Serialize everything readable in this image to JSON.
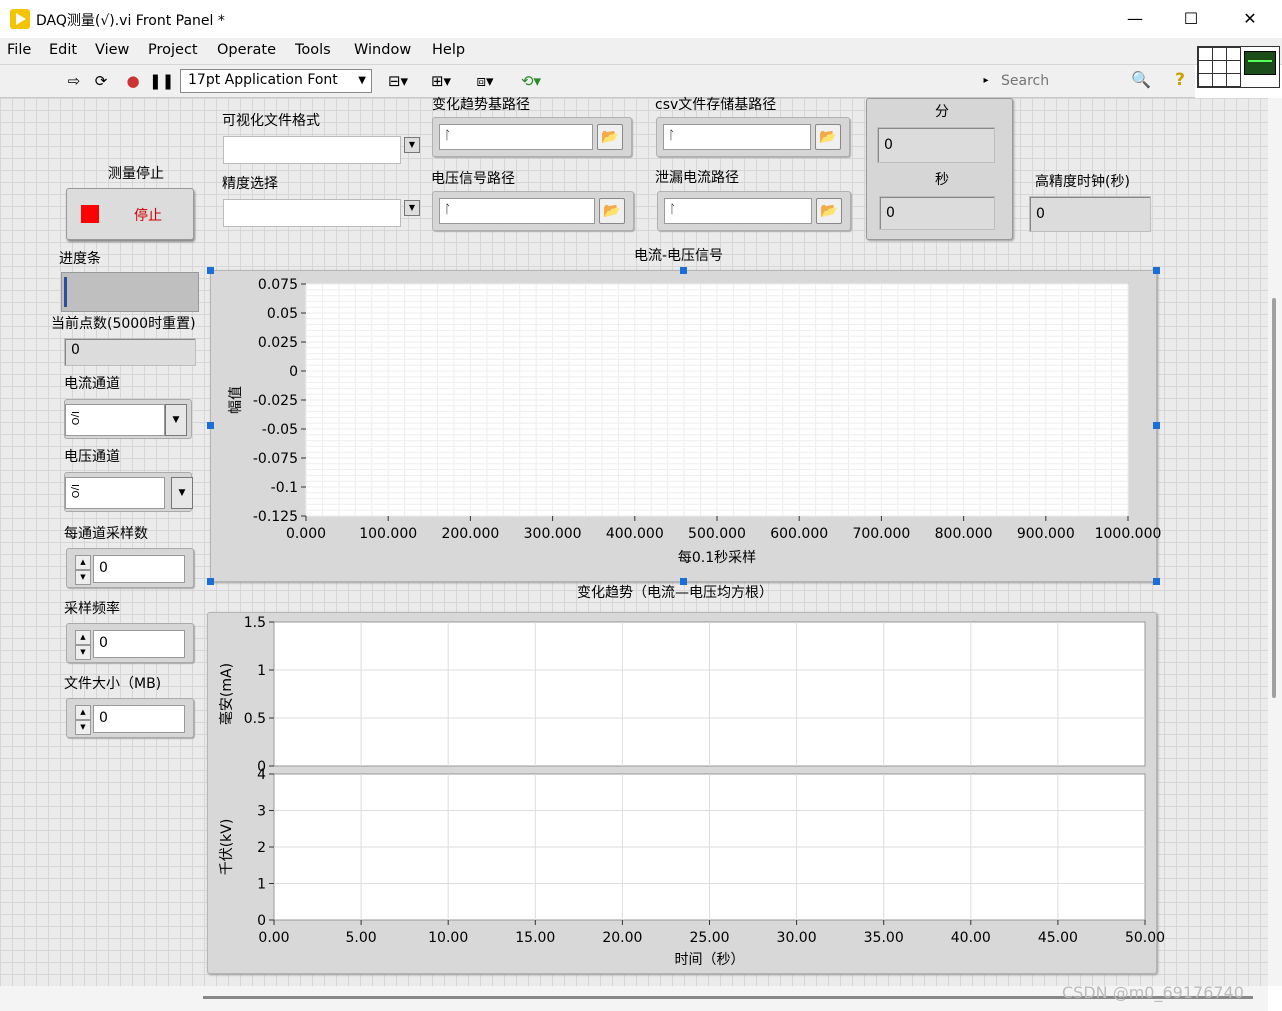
{
  "window": {
    "title": "DAQ测量(√).vi Front Panel *",
    "min": "—",
    "max": "☐",
    "close": "✕"
  },
  "menu": [
    "File",
    "Edit",
    "View",
    "Project",
    "Operate",
    "Tools",
    "Window",
    "Help"
  ],
  "toolbar": {
    "font": "17pt Application Font",
    "search_placeholder": "Search"
  },
  "controls": {
    "stop_group_label": "测量停止",
    "stop_button_label": "停止",
    "progress_label": "进度条",
    "progress_value": 0.02,
    "current_points_label": "当前点数(5000时重置)",
    "current_points_value": "0",
    "current_channel_label": "电流通道",
    "voltage_channel_label": "电压通道",
    "samples_label": "每通道采样数",
    "samples_value": "0",
    "rate_label": "采样频率",
    "rate_value": "0",
    "filesize_label": "文件大小（MB)",
    "filesize_value": "0",
    "format_label": "可视化文件格式",
    "precision_label": "精度选择",
    "trend_path_label": "变化趋势基路径",
    "voltage_path_label": "电压信号路径",
    "csv_path_label": "csv文件存储基路径",
    "leak_path_label": "泄漏电流路径",
    "minute_label": "分",
    "minute_value": "0",
    "second_label": "秒",
    "second_value": "0",
    "clock_label": "高精度时钟(秒)",
    "clock_value": "0"
  },
  "watermark": "CSDN @m0_69176740",
  "chart_data": [
    {
      "type": "line",
      "title": "电流-电压信号",
      "xlabel": "每0.1秒采样",
      "ylabel": "幅值",
      "xlim": [
        0,
        1000
      ],
      "ylim": [
        -0.125,
        0.075
      ],
      "xticks": [
        "0.000",
        "100.000",
        "200.000",
        "300.000",
        "400.000",
        "500.000",
        "600.000",
        "700.000",
        "800.000",
        "900.000",
        "1000.000"
      ],
      "yticks": [
        "0.075",
        "0.05",
        "0.025",
        "0",
        "-0.025",
        "-0.05",
        "-0.075",
        "-0.1",
        "-0.125"
      ],
      "grid": true,
      "series": []
    },
    {
      "type": "line",
      "title": "变化趋势（电流—电压均方根）",
      "xlabel": "时间（秒）",
      "xlim": [
        0,
        50
      ],
      "xticks": [
        "0.00",
        "5.00",
        "10.00",
        "15.00",
        "20.00",
        "25.00",
        "30.00",
        "35.00",
        "40.00",
        "45.00",
        "50.00"
      ],
      "plots": [
        {
          "ylabel": "毫安(mA)",
          "ylim": [
            0,
            1.5
          ],
          "yticks": [
            "1.5",
            "1",
            "0.5",
            "0"
          ]
        },
        {
          "ylabel": "千伏(kV)",
          "ylim": [
            0,
            4
          ],
          "yticks": [
            "4",
            "3",
            "2",
            "1",
            "0"
          ]
        }
      ],
      "grid": true,
      "series": []
    }
  ]
}
